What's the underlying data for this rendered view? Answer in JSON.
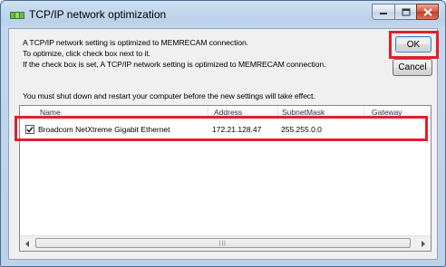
{
  "window": {
    "title": "TCP/IP network optimization",
    "controls": {
      "minimize": "minimize",
      "maximize": "maximize",
      "close": "close"
    }
  },
  "description": {
    "line1": "A TCP/IP network setting is optimized to MEMRECAM connection.",
    "line2": "To optimize, click check box next to it.",
    "line3": "If the check box is set, A TCP/IP network setting is optimized to MEMRECAM connection."
  },
  "restart_notice": "You must shut down and restart your computer before the new settings will take effect.",
  "buttons": {
    "ok": "OK",
    "cancel": "Cancel"
  },
  "list": {
    "columns": [
      "Name",
      "Address",
      "SubnetMask",
      "Gateway"
    ],
    "rows": [
      {
        "checked": true,
        "name": "Broadcom NetXtreme Gigabit Ethernet",
        "address": "172.21.128.47",
        "subnet": "255.255.0.0",
        "gateway": ""
      }
    ]
  },
  "scrollbar": {
    "grip": "|||"
  },
  "annotations": {
    "highlight_color": "#e0202a"
  }
}
